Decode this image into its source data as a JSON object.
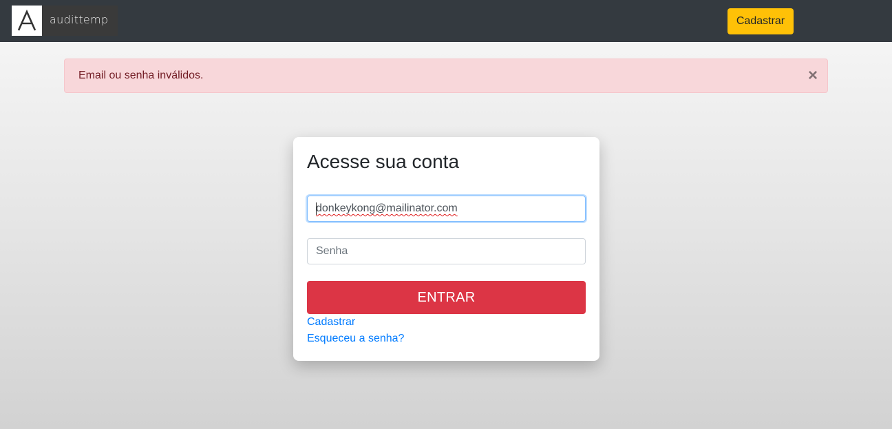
{
  "navbar": {
    "brand_name": "audittemp",
    "signup_button": "Cadastrar"
  },
  "alert": {
    "message": "Email ou senha inválidos.",
    "close_symbol": "×"
  },
  "login": {
    "title": "Acesse sua conta",
    "email_value": "donkeykong@mailinator.com",
    "password_placeholder": "Senha",
    "submit_label": "ENTRAR",
    "signup_link": "Cadastrar",
    "forgot_link": "Esqueceu a senha?"
  },
  "colors": {
    "navbar_bg": "#343a40",
    "accent_yellow": "#ffc107",
    "danger": "#dc3545",
    "alert_bg": "#f8d7da",
    "link": "#007bff"
  },
  "icons": [
    "logo-a-icon",
    "close-icon"
  ]
}
